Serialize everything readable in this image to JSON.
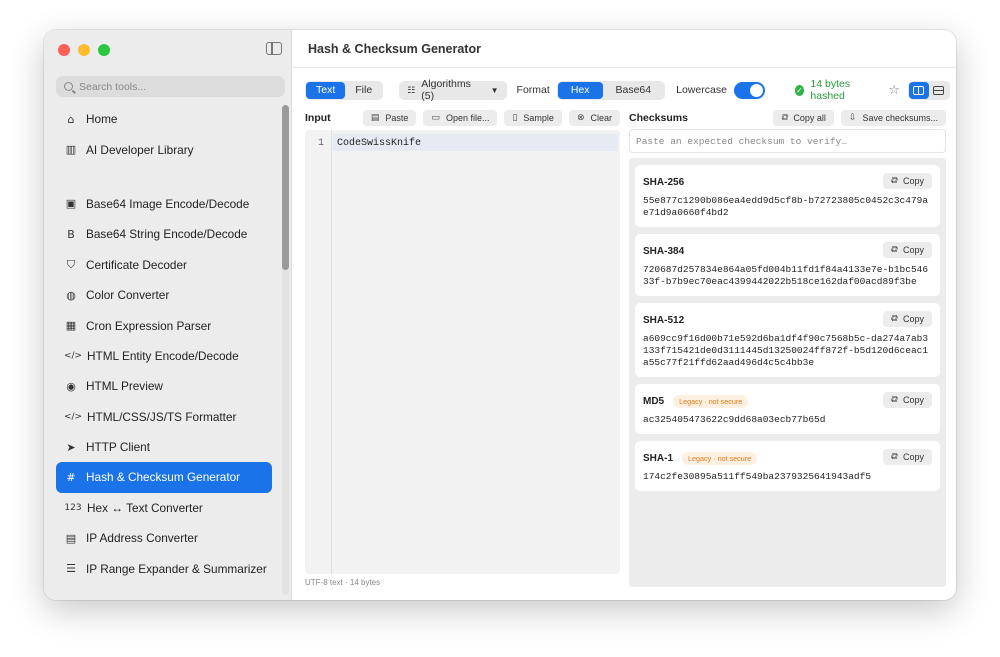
{
  "window": {
    "title": "Hash & Checksum Generator"
  },
  "search": {
    "placeholder": "Search tools..."
  },
  "sidebar": {
    "top_items": [
      {
        "label": "Home",
        "icon": "house-icon",
        "glyph": "⌂"
      },
      {
        "label": "AI Developer Library",
        "icon": "library-icon",
        "glyph": "▥"
      }
    ],
    "items": [
      {
        "label": "Base64 Image Encode/Decode",
        "icon": "image-icon",
        "glyph": "▣"
      },
      {
        "label": "Base64 String Encode/Decode",
        "icon": "b-square-icon",
        "glyph": "B"
      },
      {
        "label": "Certificate Decoder",
        "icon": "shield-check-icon",
        "glyph": "⛉"
      },
      {
        "label": "Color Converter",
        "icon": "palette-icon",
        "glyph": "◍"
      },
      {
        "label": "Cron Expression Parser",
        "icon": "calendar-clock-icon",
        "glyph": "▦"
      },
      {
        "label": "HTML Entity Encode/Decode",
        "icon": "code-brackets-icon",
        "glyph": "</>"
      },
      {
        "label": "HTML Preview",
        "icon": "eye-icon",
        "glyph": "◉"
      },
      {
        "label": "HTML/CSS/JS/TS Formatter",
        "icon": "code-brackets-icon",
        "glyph": "</>"
      },
      {
        "label": "HTTP Client",
        "icon": "paper-plane-icon",
        "glyph": "➤"
      },
      {
        "label": "Hash & Checksum Generator",
        "icon": "hash-icon",
        "glyph": "#",
        "active": true
      },
      {
        "label": "Hex ↔ Text Converter",
        "icon": "number-123-icon",
        "glyph": "123"
      },
      {
        "label": "IP Address Converter",
        "icon": "network-icon",
        "glyph": "▤"
      },
      {
        "label": "IP Range Expander & Summarizer",
        "icon": "list-icon",
        "glyph": "☰"
      }
    ]
  },
  "toolbar": {
    "mode_text": "Text",
    "mode_file": "File",
    "algorithms": "Algorithms (5)",
    "format_label": "Format",
    "format_hex": "Hex",
    "format_base64": "Base64",
    "lowercase_label": "Lowercase",
    "status": "14 bytes hashed"
  },
  "input": {
    "title": "Input",
    "paste": "Paste",
    "open_file": "Open file...",
    "sample": "Sample",
    "clear": "Clear",
    "line_number": "1",
    "content": "CodeSwissKnife",
    "footer": "UTF-8 text · 14 bytes"
  },
  "checksums": {
    "title": "Checksums",
    "copy_all": "Copy all",
    "save": "Save checksums...",
    "verify_placeholder": "Paste an expected checksum to verify…",
    "copy_label": "Copy",
    "results": [
      {
        "algo": "SHA-256",
        "badge": "",
        "hash": "55e877c1290b086ea4edd9d5cf8b-b72723805c0452c3c479ae71d9a0660f4bd2"
      },
      {
        "algo": "SHA-384",
        "badge": "",
        "hash": "720687d257834e864a05fd004b11fd1f84a4133e7e-b1bc54633f-b7b9ec70eac4399442022b518ce162daf00acd89f3be"
      },
      {
        "algo": "SHA-512",
        "badge": "",
        "hash": "a609cc9f16d00b71e592d6ba1df4f90c7568b5c-da274a7ab3133f715421de0d3111445d13250024ff872f-b5d120d6ceac1a55c77f21ffd62aad496d4c5c4bb3e"
      },
      {
        "algo": "MD5",
        "badge": "Legacy · not secure",
        "hash": "ac325405473622c9dd68a03ecb77b65d"
      },
      {
        "algo": "SHA-1",
        "badge": "Legacy · not secure",
        "hash": "174c2fe30895a511ff549ba2379325641943adf5"
      }
    ]
  },
  "colors": {
    "accent": "#1a73e8",
    "success": "#2fb344",
    "warning": "#e07b1a"
  }
}
